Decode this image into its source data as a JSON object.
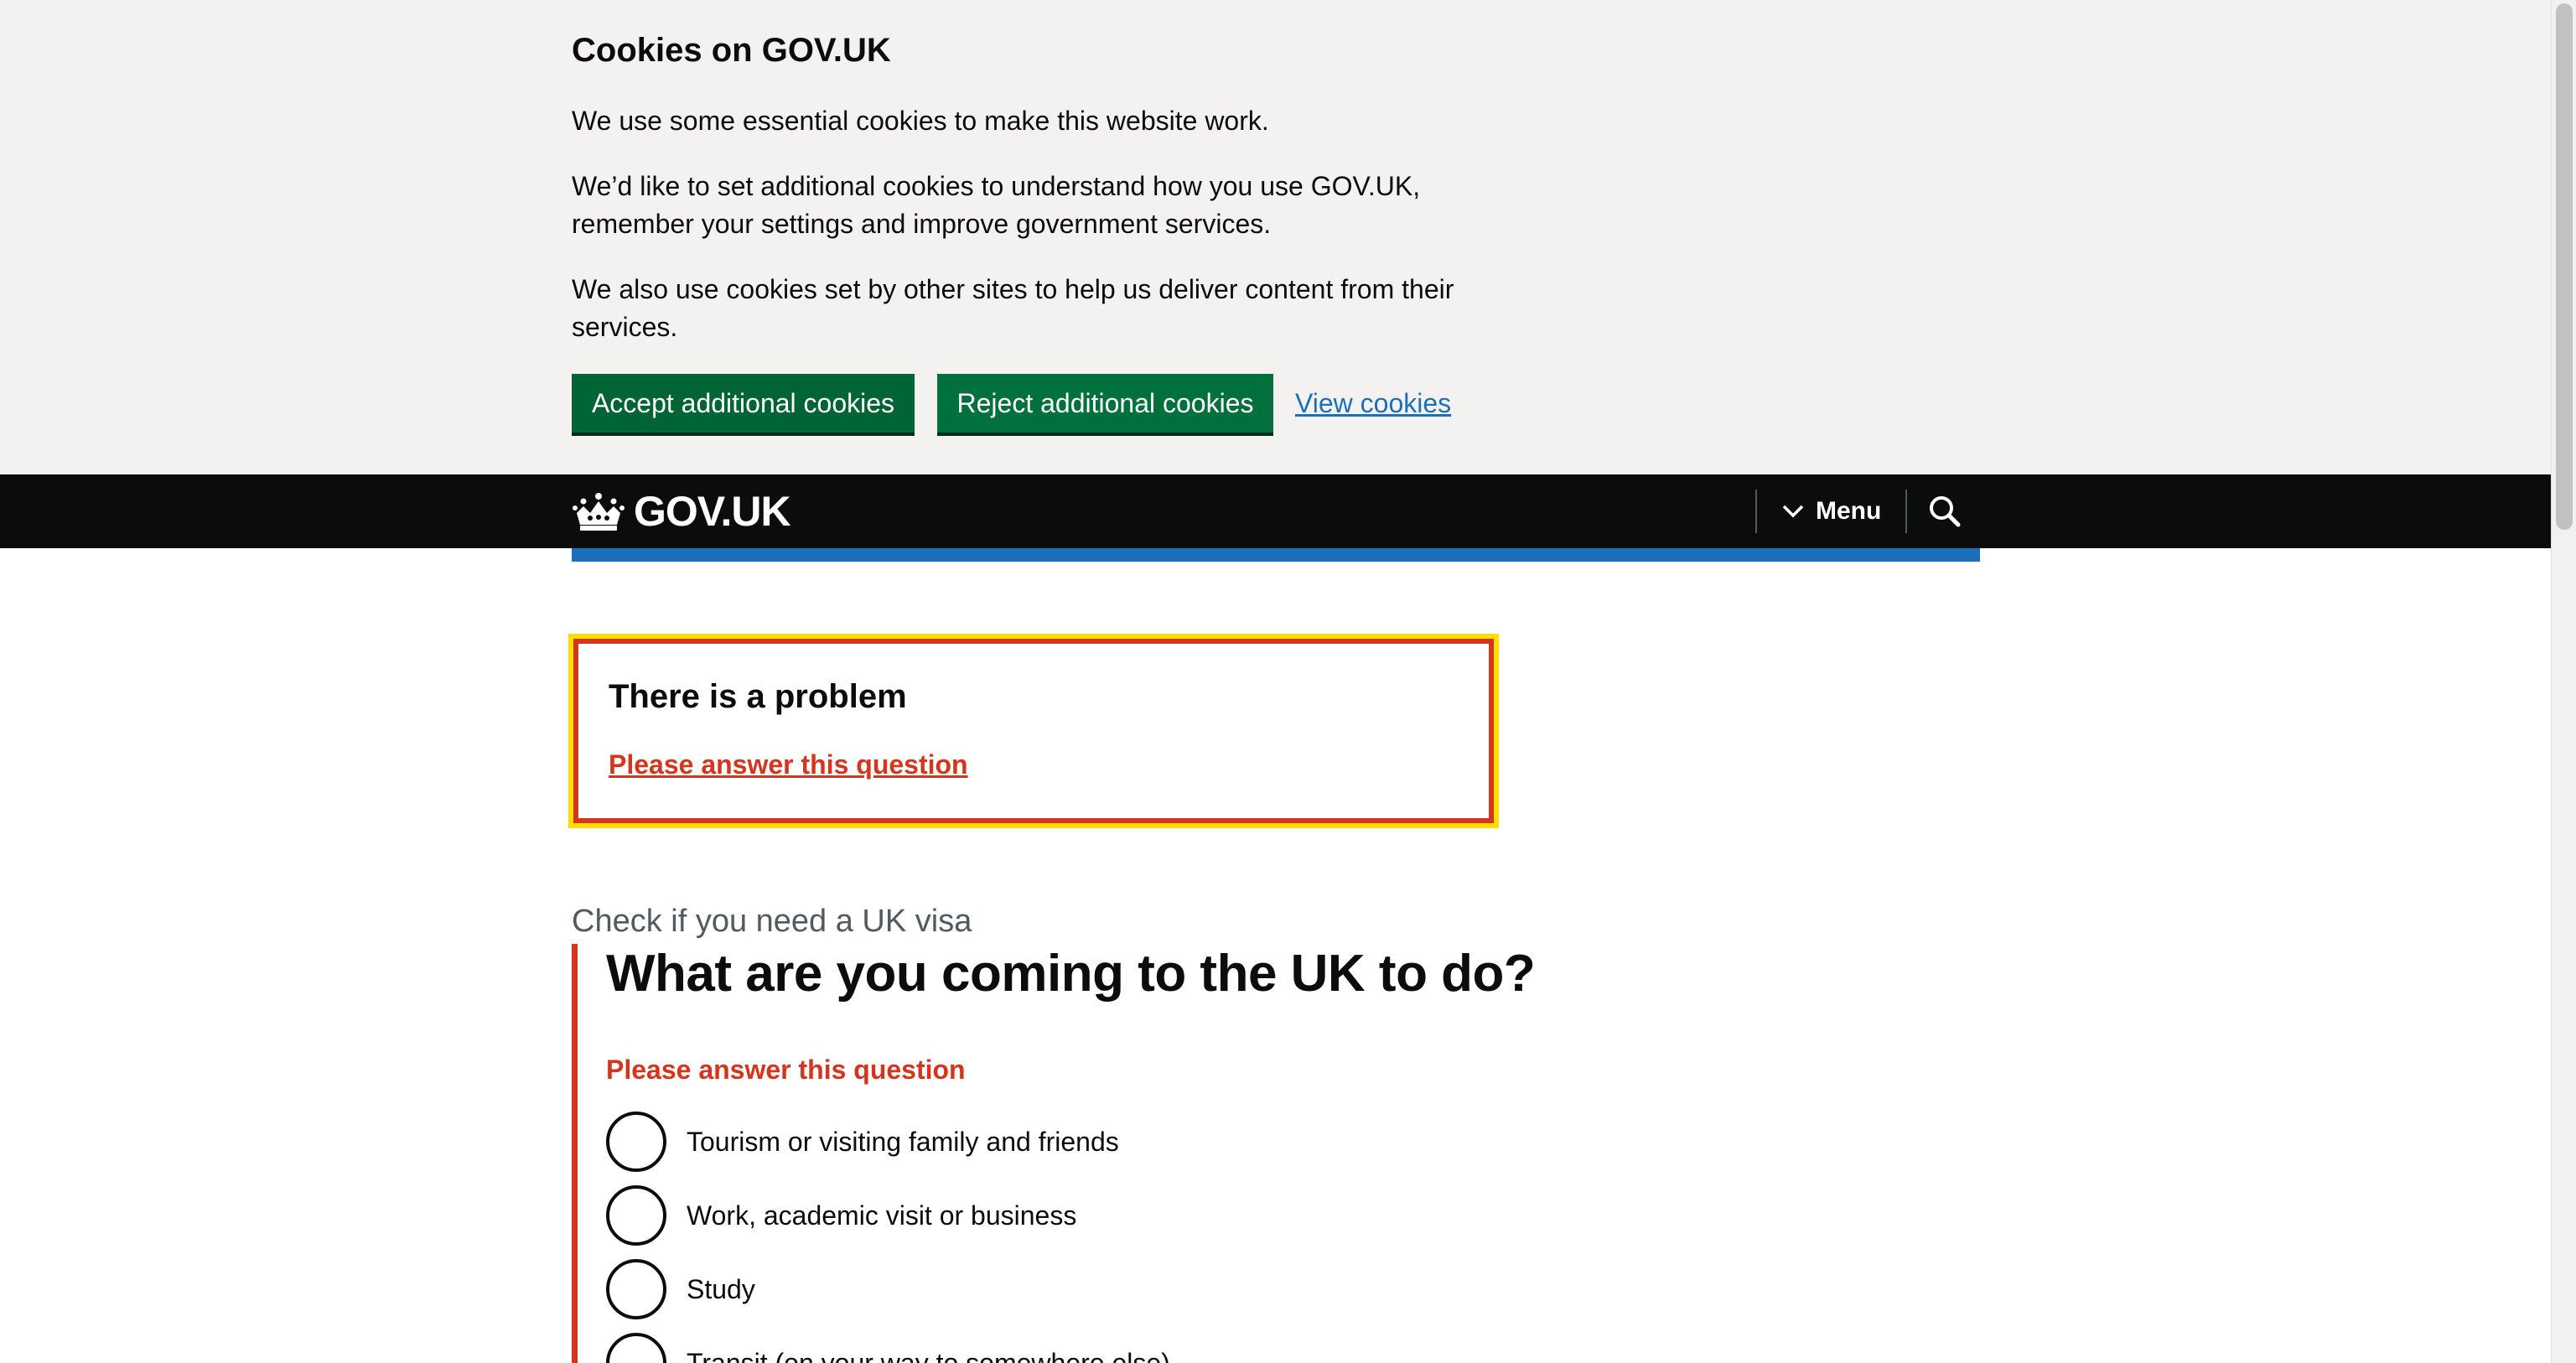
{
  "cookie_banner": {
    "title": "Cookies on GOV.UK",
    "paragraph_1": "We use some essential cookies to make this website work.",
    "paragraph_2": "We’d like to set additional cookies to understand how you use GOV.UK, remember your settings and improve government services.",
    "paragraph_3": "We also use cookies set by other sites to help us deliver content from their services.",
    "accept_label": "Accept additional cookies",
    "reject_label": "Reject additional cookies",
    "view_label": "View cookies"
  },
  "header": {
    "logo_text": "GOV.UK",
    "menu_label": "Menu",
    "icons": {
      "logo": "crown-icon",
      "menu": "chevron-down-icon",
      "search": "search-icon"
    }
  },
  "error_summary": {
    "title": "There is a problem",
    "link": "Please answer this question"
  },
  "question": {
    "caption": "Check if you need a UK visa",
    "title": "What are you coming to the UK to do?",
    "error_message": "Please answer this question",
    "options": [
      "Tourism or visiting family and friends",
      "Work, academic visit or business",
      "Study",
      "Transit (on your way to somewhere else)"
    ]
  },
  "colors": {
    "button_green": "#00703c",
    "link_blue": "#1d70b8",
    "error_red": "#d4351c",
    "focus_yellow": "#ffdd00",
    "header_black": "#0b0c0c"
  }
}
